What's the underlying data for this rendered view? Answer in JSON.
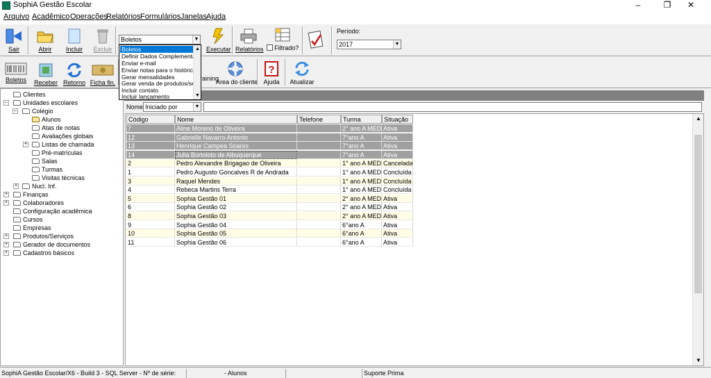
{
  "window": {
    "title": "SophiA Gestão Escolar"
  },
  "menu": [
    "Arquivo",
    "Acadêmico",
    "Operações",
    "Relatórios",
    "Formulários",
    "Janelas",
    "Ajuda"
  ],
  "toolbar1": {
    "sair": "Sair",
    "abrir": "Abrir",
    "incluir": "Incluir",
    "excluir": "Excluir",
    "action_combo": "Boletos",
    "executar": "Executar",
    "relatorios": "Relatórios",
    "filtrado": "Filtrado?",
    "periodo_label": "Período:",
    "periodo_value": "2017"
  },
  "toolbar2": {
    "boletos": "Boletos",
    "receber": "Receber",
    "retorno": "Retorno",
    "ficha_fin": "Ficha fin.",
    "training": "raining",
    "area_cliente": "Área do cliente",
    "ajuda": "Ajuda",
    "atualizar": "Atualizar"
  },
  "dropdown": {
    "items": [
      "Boletos",
      "Definir Dados Complementares",
      "Enviar e-mail",
      "Enviar notas para o histórico",
      "Gerar mensalidades",
      "Gerar venda de produtos/serviços",
      "Incluir contato",
      "Incluir lançamento"
    ]
  },
  "tree": {
    "items": [
      "Clientes",
      "Unidades escolares",
      "Colégio",
      "Alunos",
      "Atas de notas",
      "Avaliações globais",
      "Listas de chamada",
      "Pré-matrículas",
      "Salas",
      "Turmas",
      "Visitas técnicas",
      "Nucl. Inf.",
      "Finanças",
      "Colaboradores",
      "Configuração acadêmica",
      "Cursos",
      "Empresas",
      "Produtos/Serviços",
      "Gerador de documentos",
      "Cadastros básicos"
    ]
  },
  "filter": {
    "label": "Nome",
    "mode": "Iniciado por",
    "value": ""
  },
  "grid": {
    "columns": [
      "Código",
      "Nome",
      "Telefone",
      "Turma regular",
      "Situação"
    ],
    "rows": [
      [
        "7",
        "Aline Moreno de Oliveira",
        "",
        "2° ano A MED",
        "Ativa"
      ],
      [
        "12",
        "Gabrielle Navarro Antonio",
        "",
        "7°ano A",
        "Ativa"
      ],
      [
        "13",
        "Henrique Campea Soares",
        "",
        "7°ano A",
        "Ativa"
      ],
      [
        "14",
        "Julia Bortoloto de Albuquerque",
        "",
        "7°ano A",
        "Ativa"
      ],
      [
        "2",
        "Pedro Alexandre Brigagao de Oliveira",
        "",
        "1° ano A MED",
        "Cancelada"
      ],
      [
        "1",
        "Pedro Augusto Goncalves R de Andrada",
        "",
        "1° ano A MED",
        "Concluída"
      ],
      [
        "3",
        "Raquel Mendes",
        "",
        "1° ano A MED",
        "Concluída"
      ],
      [
        "4",
        "Rebeca Martins Terra",
        "",
        "1° ano A MED",
        "Concluída"
      ],
      [
        "5",
        "Sophia Gestão 01",
        "",
        "2° ano A MED",
        "Ativa"
      ],
      [
        "6",
        "Sophia Gestão 02",
        "",
        "2° ano A MED",
        "Ativa"
      ],
      [
        "8",
        "Sophia Gestão 03",
        "",
        "2° ano A MED",
        "Ativa"
      ],
      [
        "9",
        "Sophia Gestão 04",
        "",
        "6°ano A",
        "Ativa"
      ],
      [
        "10",
        "Sophia Gestão 05",
        "",
        "6°ano A",
        "Ativa"
      ],
      [
        "11",
        "Sophia Gestão 06",
        "",
        "6°ano A",
        "Ativa"
      ]
    ]
  },
  "status": {
    "build": "SophiA Gestão Escolar/X6 - Build 3 - SQL Server - Nº de série:",
    "context": "- Alunos",
    "support": "Suporte Prima"
  },
  "colors": {
    "selected_row": "#a0a0a0",
    "alt_row": "#fffde6",
    "selection_blue": "#0078d7",
    "header_gray": "#808080"
  }
}
